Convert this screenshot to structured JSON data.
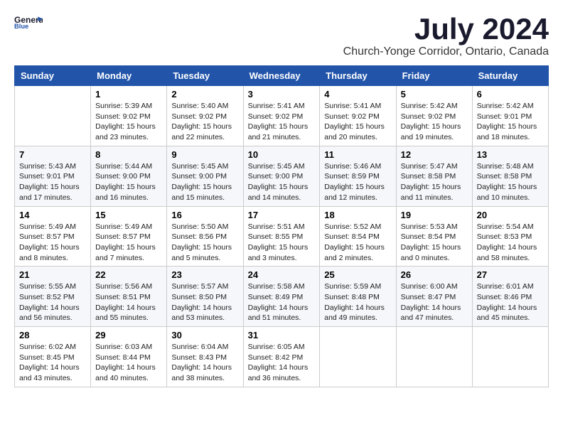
{
  "header": {
    "logo_line1": "General",
    "logo_line2": "Blue",
    "month": "July 2024",
    "location": "Church-Yonge Corridor, Ontario, Canada"
  },
  "weekdays": [
    "Sunday",
    "Monday",
    "Tuesday",
    "Wednesday",
    "Thursday",
    "Friday",
    "Saturday"
  ],
  "weeks": [
    [
      {
        "day": "",
        "info": ""
      },
      {
        "day": "1",
        "info": "Sunrise: 5:39 AM\nSunset: 9:02 PM\nDaylight: 15 hours\nand 23 minutes."
      },
      {
        "day": "2",
        "info": "Sunrise: 5:40 AM\nSunset: 9:02 PM\nDaylight: 15 hours\nand 22 minutes."
      },
      {
        "day": "3",
        "info": "Sunrise: 5:41 AM\nSunset: 9:02 PM\nDaylight: 15 hours\nand 21 minutes."
      },
      {
        "day": "4",
        "info": "Sunrise: 5:41 AM\nSunset: 9:02 PM\nDaylight: 15 hours\nand 20 minutes."
      },
      {
        "day": "5",
        "info": "Sunrise: 5:42 AM\nSunset: 9:02 PM\nDaylight: 15 hours\nand 19 minutes."
      },
      {
        "day": "6",
        "info": "Sunrise: 5:42 AM\nSunset: 9:01 PM\nDaylight: 15 hours\nand 18 minutes."
      }
    ],
    [
      {
        "day": "7",
        "info": "Sunrise: 5:43 AM\nSunset: 9:01 PM\nDaylight: 15 hours\nand 17 minutes."
      },
      {
        "day": "8",
        "info": "Sunrise: 5:44 AM\nSunset: 9:00 PM\nDaylight: 15 hours\nand 16 minutes."
      },
      {
        "day": "9",
        "info": "Sunrise: 5:45 AM\nSunset: 9:00 PM\nDaylight: 15 hours\nand 15 minutes."
      },
      {
        "day": "10",
        "info": "Sunrise: 5:45 AM\nSunset: 9:00 PM\nDaylight: 15 hours\nand 14 minutes."
      },
      {
        "day": "11",
        "info": "Sunrise: 5:46 AM\nSunset: 8:59 PM\nDaylight: 15 hours\nand 12 minutes."
      },
      {
        "day": "12",
        "info": "Sunrise: 5:47 AM\nSunset: 8:58 PM\nDaylight: 15 hours\nand 11 minutes."
      },
      {
        "day": "13",
        "info": "Sunrise: 5:48 AM\nSunset: 8:58 PM\nDaylight: 15 hours\nand 10 minutes."
      }
    ],
    [
      {
        "day": "14",
        "info": "Sunrise: 5:49 AM\nSunset: 8:57 PM\nDaylight: 15 hours\nand 8 minutes."
      },
      {
        "day": "15",
        "info": "Sunrise: 5:49 AM\nSunset: 8:57 PM\nDaylight: 15 hours\nand 7 minutes."
      },
      {
        "day": "16",
        "info": "Sunrise: 5:50 AM\nSunset: 8:56 PM\nDaylight: 15 hours\nand 5 minutes."
      },
      {
        "day": "17",
        "info": "Sunrise: 5:51 AM\nSunset: 8:55 PM\nDaylight: 15 hours\nand 3 minutes."
      },
      {
        "day": "18",
        "info": "Sunrise: 5:52 AM\nSunset: 8:54 PM\nDaylight: 15 hours\nand 2 minutes."
      },
      {
        "day": "19",
        "info": "Sunrise: 5:53 AM\nSunset: 8:54 PM\nDaylight: 15 hours\nand 0 minutes."
      },
      {
        "day": "20",
        "info": "Sunrise: 5:54 AM\nSunset: 8:53 PM\nDaylight: 14 hours\nand 58 minutes."
      }
    ],
    [
      {
        "day": "21",
        "info": "Sunrise: 5:55 AM\nSunset: 8:52 PM\nDaylight: 14 hours\nand 56 minutes."
      },
      {
        "day": "22",
        "info": "Sunrise: 5:56 AM\nSunset: 8:51 PM\nDaylight: 14 hours\nand 55 minutes."
      },
      {
        "day": "23",
        "info": "Sunrise: 5:57 AM\nSunset: 8:50 PM\nDaylight: 14 hours\nand 53 minutes."
      },
      {
        "day": "24",
        "info": "Sunrise: 5:58 AM\nSunset: 8:49 PM\nDaylight: 14 hours\nand 51 minutes."
      },
      {
        "day": "25",
        "info": "Sunrise: 5:59 AM\nSunset: 8:48 PM\nDaylight: 14 hours\nand 49 minutes."
      },
      {
        "day": "26",
        "info": "Sunrise: 6:00 AM\nSunset: 8:47 PM\nDaylight: 14 hours\nand 47 minutes."
      },
      {
        "day": "27",
        "info": "Sunrise: 6:01 AM\nSunset: 8:46 PM\nDaylight: 14 hours\nand 45 minutes."
      }
    ],
    [
      {
        "day": "28",
        "info": "Sunrise: 6:02 AM\nSunset: 8:45 PM\nDaylight: 14 hours\nand 43 minutes."
      },
      {
        "day": "29",
        "info": "Sunrise: 6:03 AM\nSunset: 8:44 PM\nDaylight: 14 hours\nand 40 minutes."
      },
      {
        "day": "30",
        "info": "Sunrise: 6:04 AM\nSunset: 8:43 PM\nDaylight: 14 hours\nand 38 minutes."
      },
      {
        "day": "31",
        "info": "Sunrise: 6:05 AM\nSunset: 8:42 PM\nDaylight: 14 hours\nand 36 minutes."
      },
      {
        "day": "",
        "info": ""
      },
      {
        "day": "",
        "info": ""
      },
      {
        "day": "",
        "info": ""
      }
    ]
  ]
}
